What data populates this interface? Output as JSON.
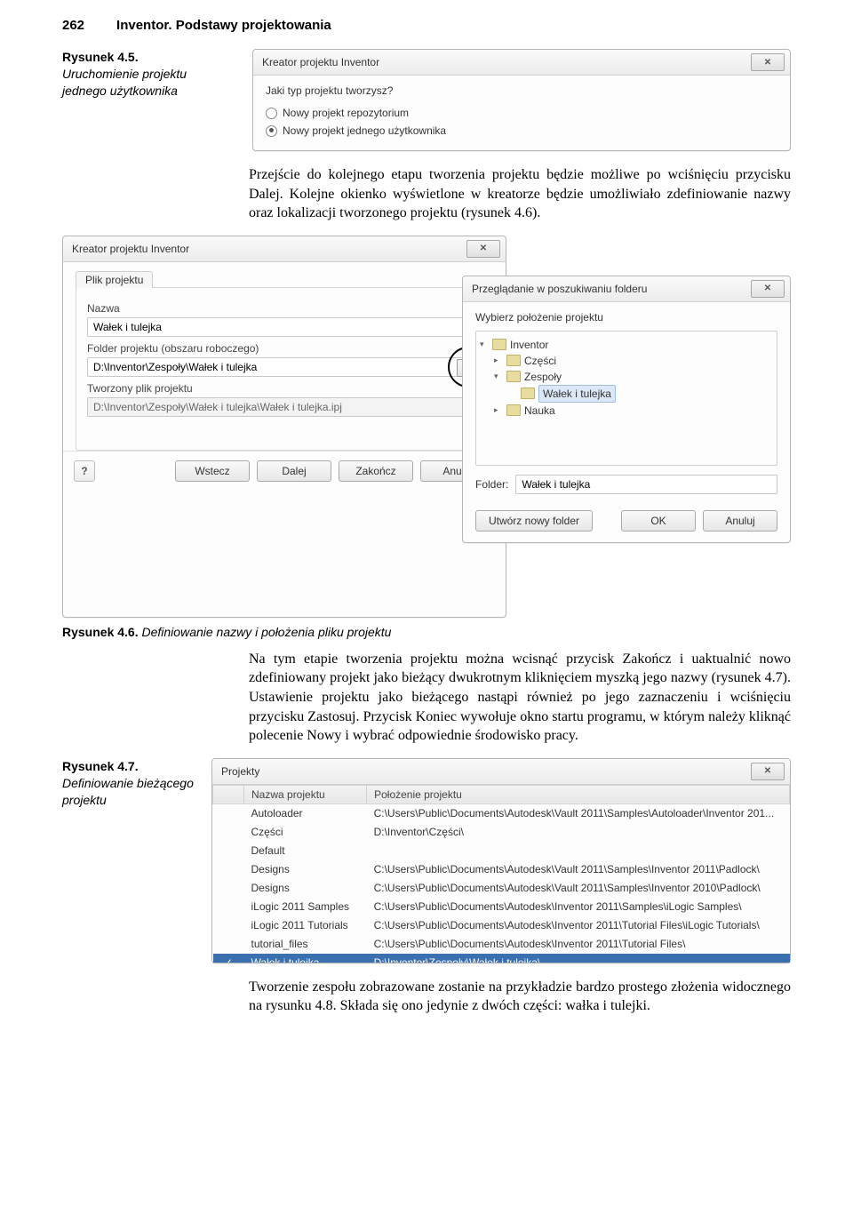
{
  "page": {
    "number": "262",
    "running_title": "Inventor. Podstawy projektowania"
  },
  "fig45": {
    "number": "Rysunek 4.5.",
    "desc": "Uruchomienie projektu jednego użytkownika",
    "dialog": {
      "title": "Kreator projektu Inventor",
      "question": "Jaki typ projektu tworzysz?",
      "opt_repo": "Nowy projekt repozytorium",
      "opt_single": "Nowy projekt jednego użytkownika",
      "close": "✕"
    }
  },
  "para1": "Przejście do kolejnego etapu tworzenia projektu będzie możliwe po wciśnięciu przycisku Dalej. Kolejne okienko wyświetlone w kreatorze będzie umożliwiało zdefiniowanie nazwy oraz lokalizacji tworzonego projektu (rysunek 4.6).",
  "fig46": {
    "main": {
      "title": "Kreator projektu Inventor",
      "close": "✕",
      "tab": "Plik projektu",
      "name_label": "Nazwa",
      "name_value": "Wałek i tulejka",
      "folder_label": "Folder projektu (obszaru roboczego)",
      "folder_value": "D:\\Inventor\\Zespoły\\Wałek i tulejka",
      "browse": "...",
      "created_label": "Tworzony plik projektu",
      "created_value": "D:\\Inventor\\Zespoły\\Wałek i tulejka\\Wałek i tulejka.ipj",
      "help": "?",
      "btn_back": "Wstecz",
      "btn_next": "Dalej",
      "btn_finish": "Zakończ",
      "btn_cancel": "Anuluj"
    },
    "browse": {
      "title": "Przeglądanie w poszukiwaniu folderu",
      "close": "✕",
      "prompt": "Wybierz położenie projektu",
      "tree": {
        "root": "Inventor",
        "child1": "Części",
        "child2": "Zespoły",
        "child2a": "Wałek i tulejka",
        "child3": "Nauka"
      },
      "folder_label": "Folder:",
      "folder_value": "Wałek i tulejka",
      "btn_newfolder": "Utwórz nowy folder",
      "btn_ok": "OK",
      "btn_cancel": "Anuluj"
    }
  },
  "fig46_caption": {
    "number": "Rysunek 4.6.",
    "desc": "Definiowanie nazwy i położenia pliku projektu"
  },
  "para2": "Na tym etapie tworzenia projektu można wcisnąć przycisk Zakończ i uaktualnić nowo zdefiniowany projekt jako bieżący dwukrotnym kliknięciem myszką jego nazwy (rysunek 4.7). Ustawienie projektu jako bieżącego nastąpi również po jego zaznaczeniu i wciśnięciu przycisku Zastosuj. Przycisk Koniec wywołuje okno startu programu, w którym należy kliknąć polecenie Nowy i wybrać odpowiednie środowisko pracy.",
  "fig47": {
    "number": "Rysunek 4.7.",
    "desc": "Definiowanie bieżącego projektu",
    "dialog": {
      "title": "Projekty",
      "close": "✕",
      "col_name": "Nazwa projektu",
      "col_path": "Położenie projektu",
      "rows": [
        {
          "name": "Autoloader",
          "path": "C:\\Users\\Public\\Documents\\Autodesk\\Vault 2011\\Samples\\Autoloader\\Inventor 201..."
        },
        {
          "name": "Części",
          "path": "D:\\Inventor\\Części\\"
        },
        {
          "name": "Default",
          "path": ""
        },
        {
          "name": "Designs",
          "path": "C:\\Users\\Public\\Documents\\Autodesk\\Vault 2011\\Samples\\Inventor 2011\\Padlock\\"
        },
        {
          "name": "Designs",
          "path": "C:\\Users\\Public\\Documents\\Autodesk\\Vault 2011\\Samples\\Inventor 2010\\Padlock\\"
        },
        {
          "name": "iLogic 2011 Samples",
          "path": "C:\\Users\\Public\\Documents\\Autodesk\\Inventor 2011\\Samples\\iLogic Samples\\"
        },
        {
          "name": "iLogic 2011 Tutorials",
          "path": "C:\\Users\\Public\\Documents\\Autodesk\\Inventor 2011\\Tutorial Files\\iLogic Tutorials\\"
        },
        {
          "name": "tutorial_files",
          "path": "C:\\Users\\Public\\Documents\\Autodesk\\Inventor 2011\\Tutorial Files\\"
        },
        {
          "name": "Wałek i tulejka",
          "path": "D:\\Inventor\\Zespoły\\Wałek i tulejka\\",
          "selected": true,
          "checked": true
        }
      ]
    }
  },
  "para3": "Tworzenie zespołu zobrazowane zostanie na przykładzie bardzo prostego złożenia widocznego na rysunku 4.8. Składa się ono jedynie z dwóch części: wałka i tulejki."
}
